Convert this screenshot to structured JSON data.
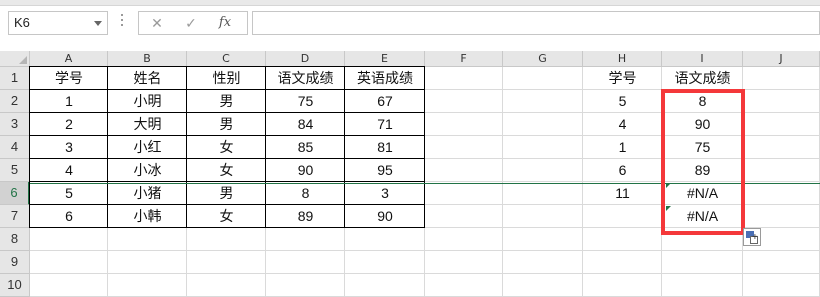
{
  "formula_bar": {
    "name_box": "K6",
    "cancel_icon": "✕",
    "enter_icon": "✓",
    "function_icon": "fx",
    "formula": ""
  },
  "columns": [
    "A",
    "B",
    "C",
    "D",
    "E",
    "F",
    "G",
    "H",
    "I",
    "J"
  ],
  "rows": [
    "1",
    "2",
    "3",
    "4",
    "5",
    "6",
    "7",
    "8",
    "9",
    "10"
  ],
  "active_row": "6",
  "left_table": {
    "headers": [
      "学号",
      "姓名",
      "性别",
      "语文成绩",
      "英语成绩"
    ],
    "rows": [
      [
        "1",
        "小明",
        "男",
        "75",
        "67"
      ],
      [
        "2",
        "大明",
        "男",
        "84",
        "71"
      ],
      [
        "3",
        "小红",
        "女",
        "85",
        "81"
      ],
      [
        "4",
        "小冰",
        "女",
        "90",
        "95"
      ],
      [
        "5",
        "小猪",
        "男",
        "8",
        "3"
      ],
      [
        "6",
        "小韩",
        "女",
        "89",
        "90"
      ]
    ]
  },
  "lookup_table": {
    "headers": [
      "学号",
      "语文成绩"
    ],
    "rows": [
      [
        "5",
        "8"
      ],
      [
        "4",
        "90"
      ],
      [
        "1",
        "75"
      ],
      [
        "6",
        "89"
      ],
      [
        "11",
        "#N/A"
      ],
      [
        "",
        "#N/A"
      ]
    ]
  },
  "colors": {
    "highlight_border": "#f4383a",
    "selection": "#217346",
    "header_bg": "#e6e6e6"
  }
}
